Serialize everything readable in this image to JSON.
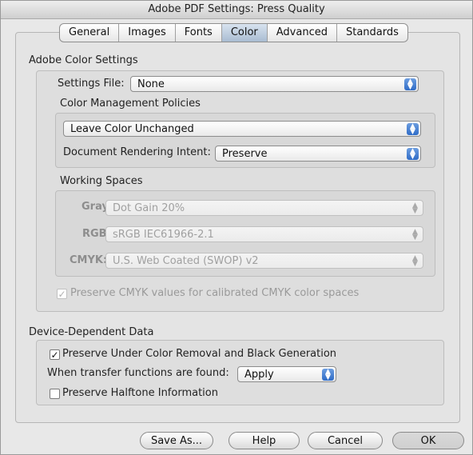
{
  "window": {
    "title": "Adobe PDF Settings: Press Quality"
  },
  "tabs": [
    {
      "label": "General"
    },
    {
      "label": "Images"
    },
    {
      "label": "Fonts"
    },
    {
      "label": "Color",
      "active": true
    },
    {
      "label": "Advanced"
    },
    {
      "label": "Standards"
    }
  ],
  "color_settings": {
    "section_title": "Adobe Color Settings",
    "settings_file_label": "Settings File:",
    "settings_file_value": "None",
    "policies_title": "Color Management Policies",
    "policy_value": "Leave Color Unchanged",
    "intent_label": "Document Rendering Intent:",
    "intent_value": "Preserve",
    "working_spaces_title": "Working Spaces",
    "gray_label": "Gray:",
    "gray_value": "Dot Gain 20%",
    "rgb_label": "RGB:",
    "rgb_value": "sRGB IEC61966-2.1",
    "cmyk_label": "CMYK:",
    "cmyk_value": "U.S. Web Coated (SWOP) v2",
    "preserve_cmyk_label": "Preserve CMYK values for calibrated CMYK color spaces",
    "preserve_cmyk_checked": true
  },
  "device_data": {
    "section_title": "Device-Dependent Data",
    "ucr_label": "Preserve Under Color Removal and Black Generation",
    "ucr_checked": true,
    "transfer_label": "When transfer functions are found:",
    "transfer_value": "Apply",
    "halftone_label": "Preserve Halftone Information",
    "halftone_checked": false
  },
  "buttons": {
    "save_as": "Save As...",
    "help": "Help",
    "cancel": "Cancel",
    "ok": "OK"
  },
  "glyphs": {
    "check": "✓",
    "arrows": "▲▼"
  }
}
